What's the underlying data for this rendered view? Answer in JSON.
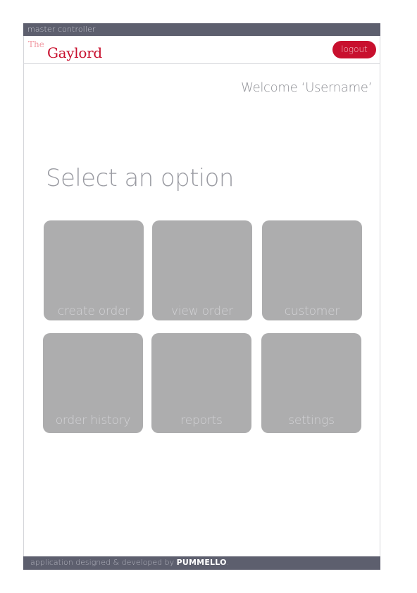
{
  "top_bar": {
    "label": "master controller"
  },
  "header": {
    "logo_prefix": "The",
    "logo_name": "Gaylord",
    "logout_label": "logout"
  },
  "main": {
    "welcome": "Welcome ‘Username’",
    "title": "Select an option",
    "tiles": [
      {
        "label": "create order"
      },
      {
        "label": "view order"
      },
      {
        "label": "customer"
      },
      {
        "label": "order history"
      },
      {
        "label": "reports"
      },
      {
        "label": "settings"
      }
    ]
  },
  "footer": {
    "credit": "application designed & developed by ",
    "brand": "PUMMELLO",
    "suffix": "."
  },
  "colors": {
    "bar": "#5d5f6e",
    "brand_red": "#c8102e",
    "tile": "#adadae"
  }
}
